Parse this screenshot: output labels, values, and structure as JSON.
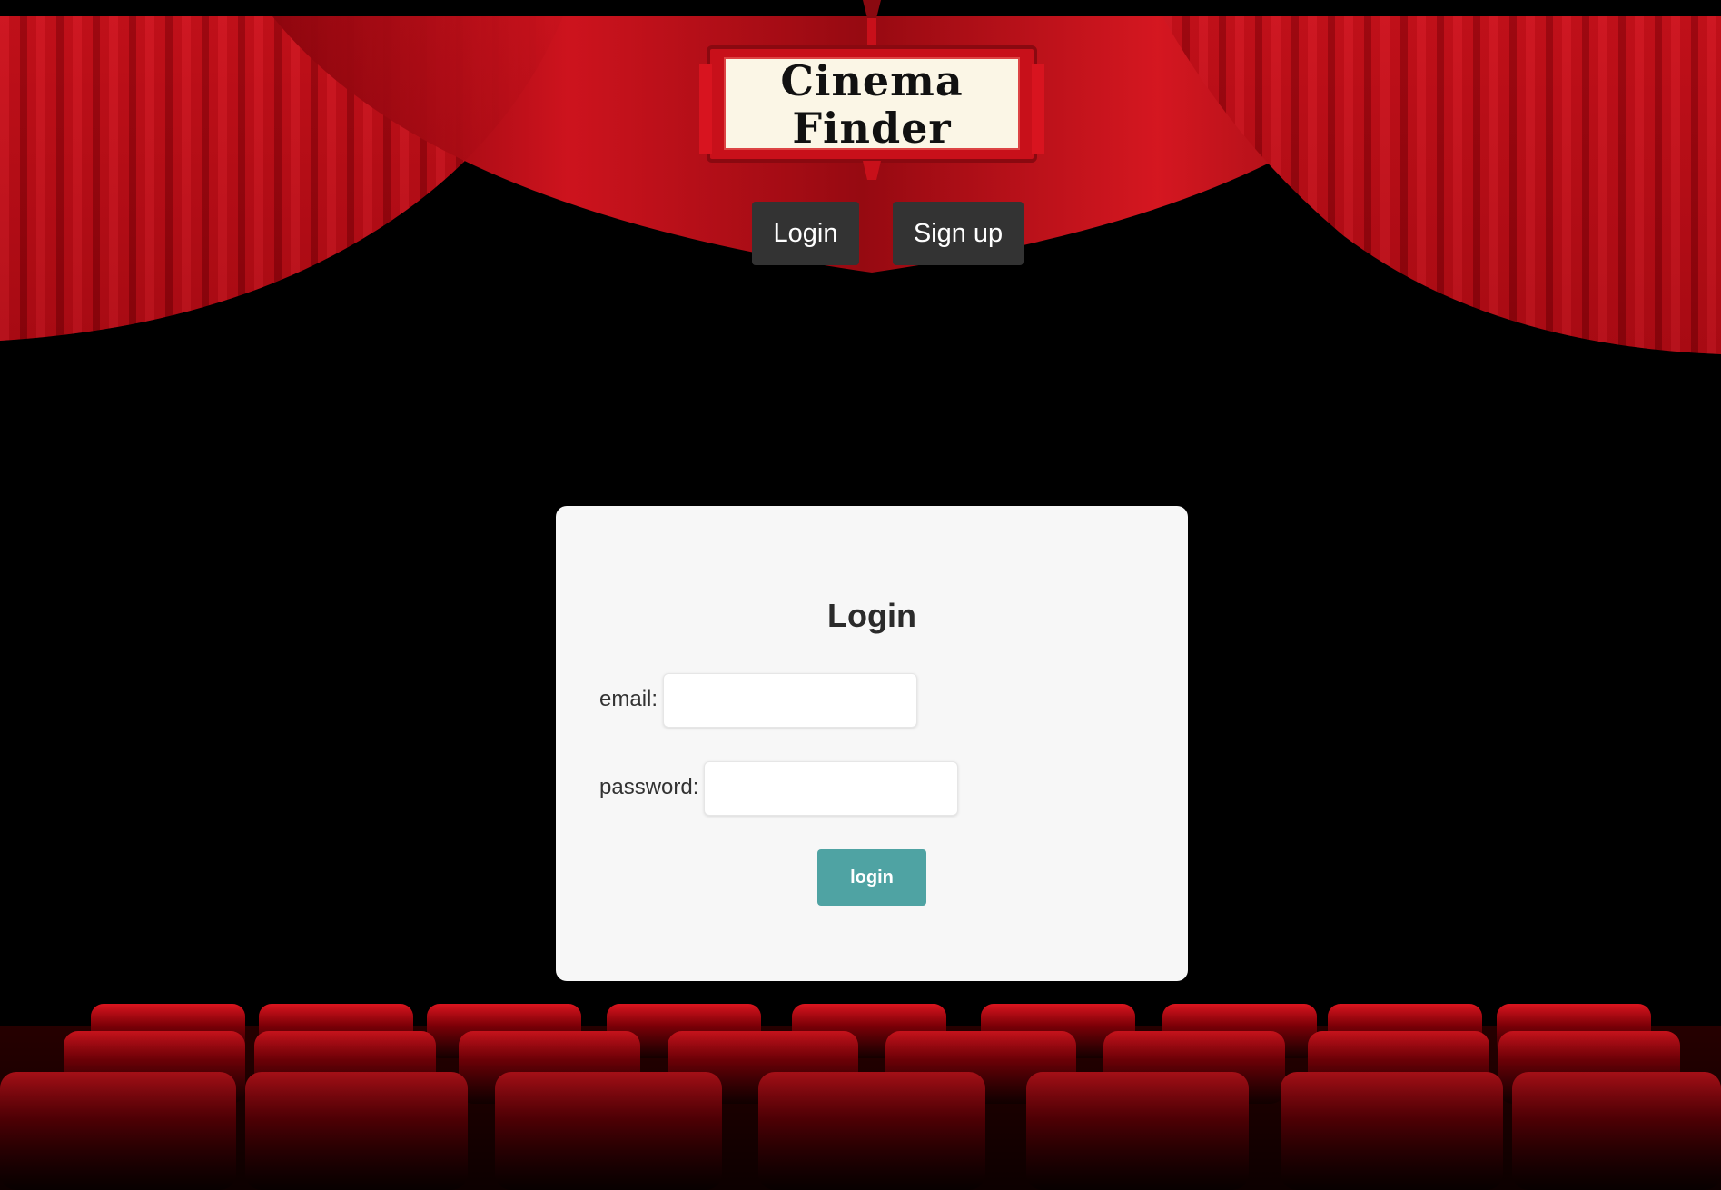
{
  "logo": {
    "line1": "Cinema",
    "line2": "Finder"
  },
  "nav": {
    "login_label": "Login",
    "signup_label": "Sign up"
  },
  "login_form": {
    "title": "Login",
    "email_label": "email:",
    "email_value": "",
    "password_label": "password:",
    "password_value": "",
    "submit_label": "login"
  },
  "colors": {
    "background": "#000000",
    "curtain": "#c8101a",
    "nav_button": "#333333",
    "card": "#f7f7f7",
    "submit_button": "#4fa3a3"
  }
}
